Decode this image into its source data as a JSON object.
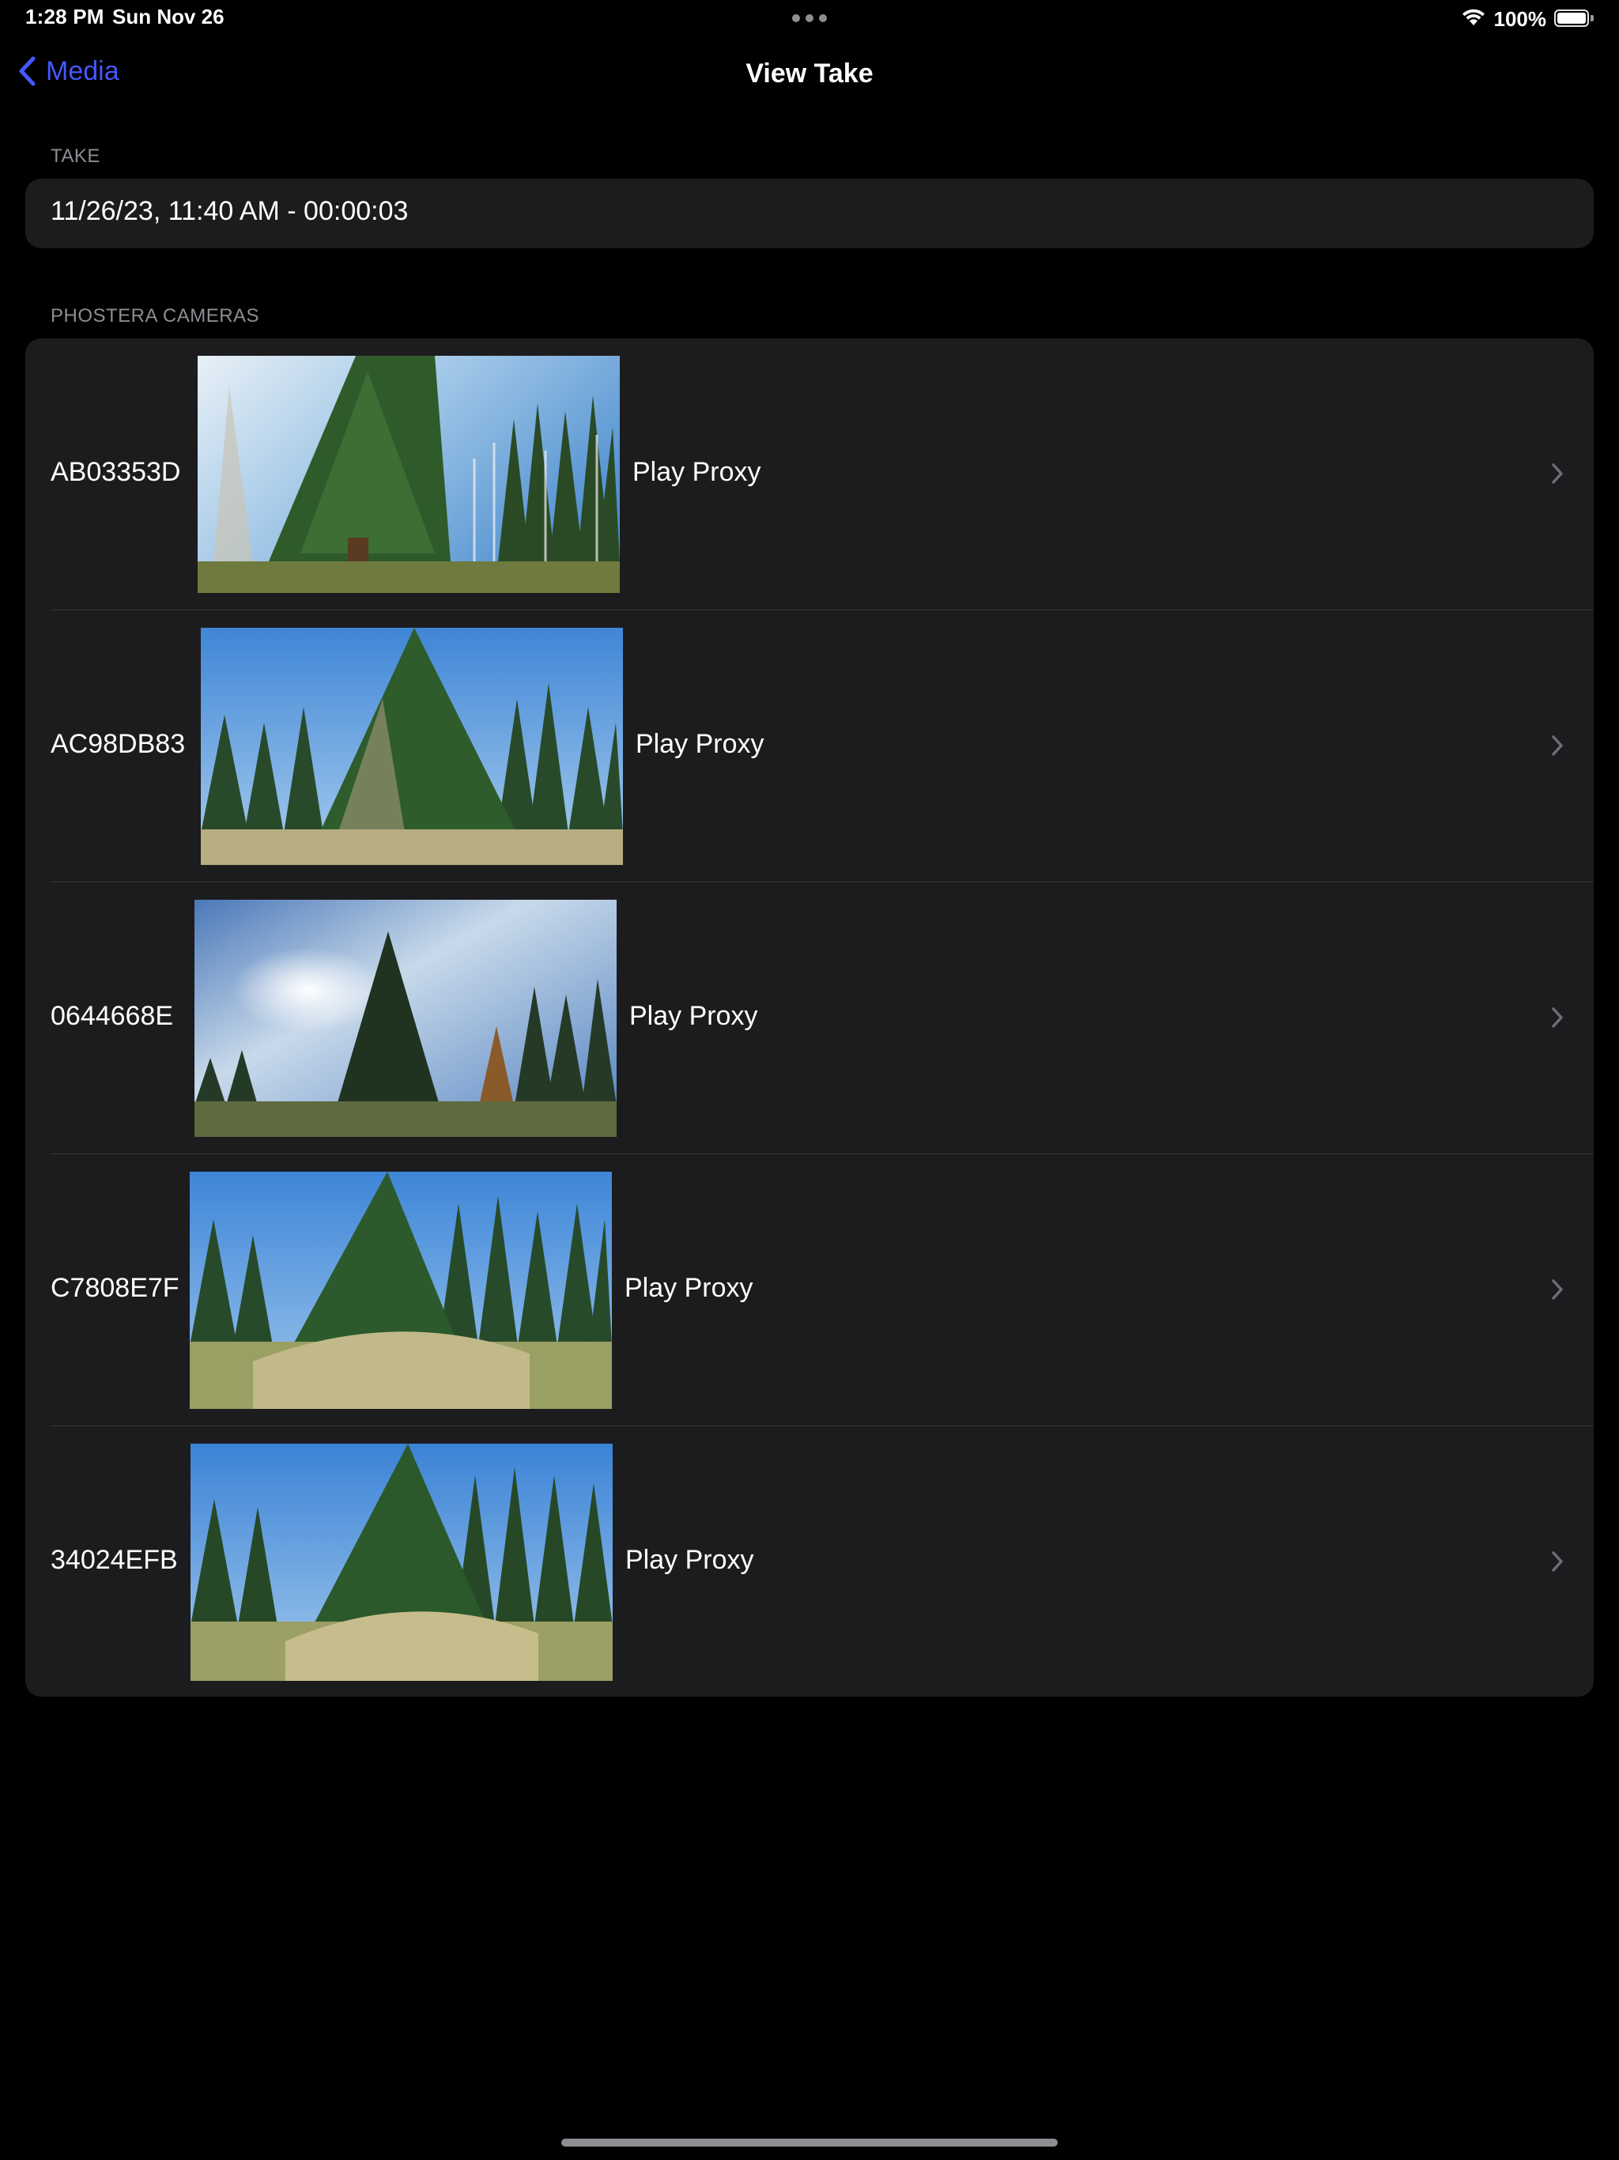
{
  "status_bar": {
    "time": "1:28 PM",
    "date": "Sun Nov 26",
    "battery_percent": "100%",
    "icons": [
      "wifi-icon",
      "battery-icon",
      "multitask-dots-icon"
    ]
  },
  "nav": {
    "back_label": "Media",
    "title": "View Take"
  },
  "take_section": {
    "header": "TAKE",
    "value": "11/26/23, 11:40 AM - 00:00:03"
  },
  "cameras_section": {
    "header": "PHOSTERA CAMERAS",
    "rows": [
      {
        "camera_id": "AB03353D",
        "action": "Play Proxy"
      },
      {
        "camera_id": "AC98DB83",
        "action": "Play Proxy"
      },
      {
        "camera_id": "0644668E",
        "action": "Play Proxy"
      },
      {
        "camera_id": "C7808E7F",
        "action": "Play Proxy"
      },
      {
        "camera_id": "34024EFB",
        "action": "Play Proxy"
      }
    ]
  },
  "colors": {
    "background": "#000000",
    "card": "#1c1c1e",
    "accent": "#4558ff",
    "secondary_text": "#8d8d93"
  }
}
